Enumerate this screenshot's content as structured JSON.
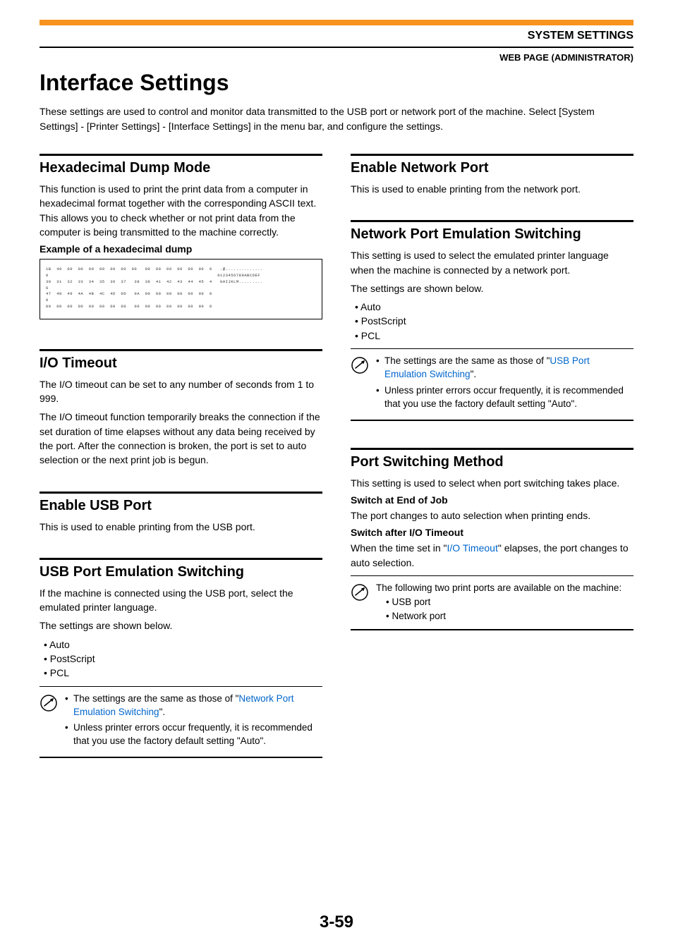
{
  "header": {
    "system_settings": "SYSTEM SETTINGS",
    "breadcrumb": "WEB PAGE (ADMINISTRATOR)"
  },
  "title": "Interface Settings",
  "intro": "These settings are used to control and monitor data transmitted to the USB port or network port of the machine. Select [System Settings] - [Printer Settings] - [Interface Settings] in the menu bar, and configure the settings.",
  "hex_dump": {
    "heading": "Hexadecimal Dump Mode",
    "body": "This function is used to print the print data from a computer in hexadecimal format together with the corresponding ASCII text. This allows you to check whether or not print data from the computer is being transmitted to the machine correctly.",
    "example_label": "Example of a hexadecimal dump",
    "dump_text": "1B  40  00  00  00  00  00  00  00   00  00  00  00  00  00  0   .@..............\n0                                                               0123456789ABCDEF\n30  31  32  33  34  35  36  37   38  39  41  42  43  44  45  4   GHIJKLM.........\n6\n47  48  49  4A  4B  4C  4D  0D   0A  00  00  00  00  00  00  0\n0\n00  00  00  00  00  00  00  00   00  00  00  00  00  00  00  0"
  },
  "io_timeout": {
    "heading": "I/O Timeout",
    "body1": "The I/O timeout can be set to any number of seconds from 1 to 999.",
    "body2": "The I/O timeout function temporarily breaks the connection if the set duration of time elapses without any data being received by the port. After the connection is broken, the port is set to auto selection or the next print job is begun."
  },
  "enable_usb": {
    "heading": "Enable USB Port",
    "body": "This is used to enable printing from the USB port."
  },
  "usb_emu": {
    "heading": "USB Port Emulation Switching",
    "body1": "If the machine is connected using the USB port, select the emulated printer language.",
    "body2": "The settings are shown below.",
    "items": [
      "Auto",
      "PostScript",
      "PCL"
    ],
    "note1_pre": "The settings are the same as those of \"",
    "note1_link": "Network Port Emulation Switching",
    "note1_post": "\".",
    "note2": "Unless printer errors occur frequently, it is recommended that you use the factory default setting \"Auto\"."
  },
  "enable_net": {
    "heading": "Enable Network Port",
    "body": "This is used to enable printing from the network port."
  },
  "net_emu": {
    "heading": "Network Port Emulation Switching",
    "body1": "This setting is used to select the emulated printer language when the machine is connected by a network port.",
    "body2": "The settings are shown below.",
    "items": [
      "Auto",
      "PostScript",
      "PCL"
    ],
    "note1_pre": "The settings are the same as those of \"",
    "note1_link": "USB Port Emulation Switching",
    "note1_post": "\".",
    "note2": "Unless printer errors occur frequently, it is recommended that you use the factory default setting \"Auto\"."
  },
  "port_switch": {
    "heading": "Port Switching Method",
    "body": "This setting is used to select when port switching takes place.",
    "sub1_title": "Switch at End of Job",
    "sub1_body": "The port changes to auto selection when printing ends.",
    "sub2_title": "Switch after I/O Timeout",
    "sub2_body_pre": "When the time set in \"",
    "sub2_link": "I/O Timeout",
    "sub2_body_post": "\" elapses, the port changes to auto selection.",
    "note_intro": "The following two print ports are available on the machine:",
    "note_items": [
      "USB port",
      "Network port"
    ]
  },
  "page_number": "3-59"
}
